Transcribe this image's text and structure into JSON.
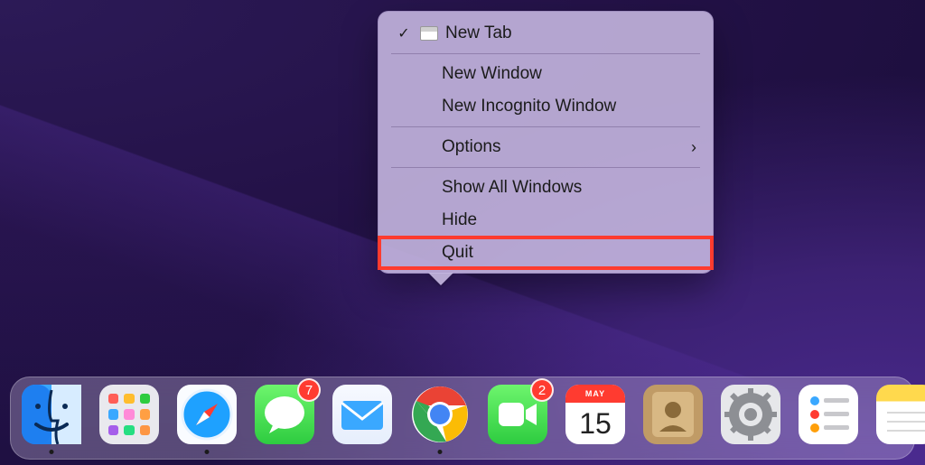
{
  "contextMenu": {
    "newTab": "New Tab",
    "newWindow": "New Window",
    "newIncognito": "New Incognito Window",
    "options": "Options",
    "showAll": "Show All Windows",
    "hide": "Hide",
    "quit": "Quit"
  },
  "dock": {
    "messagesBadge": "7",
    "facetimeBadge": "2",
    "calendar": {
      "month": "MAY",
      "day": "15"
    }
  }
}
